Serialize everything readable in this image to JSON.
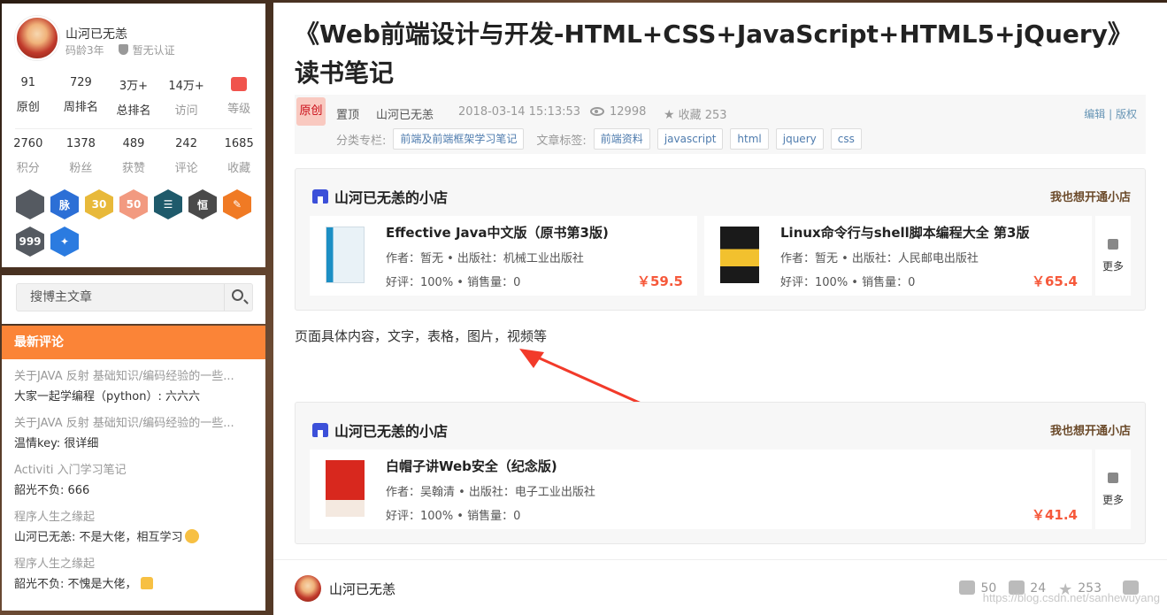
{
  "profile": {
    "name": "山河已无恙",
    "age": "码龄3年",
    "cert": "暂无认证",
    "row1": [
      {
        "v": "91",
        "l": "原创"
      },
      {
        "v": "729",
        "l": "周排名"
      },
      {
        "v": "3万+",
        "l": "总排名"
      },
      {
        "v": "14万+",
        "l": "访问"
      },
      {
        "v": "",
        "l": "等级"
      }
    ],
    "row2": [
      {
        "v": "2760",
        "l": "积分"
      },
      {
        "v": "1378",
        "l": "粉丝"
      },
      {
        "v": "489",
        "l": "获赞"
      },
      {
        "v": "242",
        "l": "评论"
      },
      {
        "v": "1685",
        "l": "收藏"
      }
    ],
    "badges": [
      {
        "name": "github-badge",
        "text": "",
        "color": "#555a61"
      },
      {
        "name": "mai-badge",
        "text": "脉",
        "color": "#2c6fd6"
      },
      {
        "name": "30-badge",
        "text": "30",
        "color": "#e8b93a"
      },
      {
        "name": "50-badge",
        "text": "50",
        "color": "#f29a80"
      },
      {
        "name": "list-badge",
        "text": "☰",
        "color": "#1f5a6b"
      },
      {
        "name": "qi-badge",
        "text": "恒",
        "color": "#4a4a4a"
      },
      {
        "name": "pen-badge",
        "text": "✎",
        "color": "#f07a24"
      },
      {
        "name": "999-badge",
        "text": "999",
        "color": "#555a61"
      },
      {
        "name": "blue-badge",
        "text": "✦",
        "color": "#2b7be0"
      }
    ]
  },
  "search": {
    "placeholder": "搜博主文章"
  },
  "comments": {
    "title": "最新评论",
    "items": [
      {
        "article": "关于JAVA 反射 基础知识/编码经验的一些...",
        "text": "大家一起学编程（python）: 六六六"
      },
      {
        "article": "关于JAVA 反射 基础知识/编码经验的一些...",
        "text": "温情key: 很详细"
      },
      {
        "article": "Activiti 入门学习笔记",
        "text": "韶光不负: 666"
      },
      {
        "article": "程序人生之缘起",
        "text": "山河已无恙: 不是大佬，相互学习"
      },
      {
        "article": "程序人生之缘起",
        "text": "韶光不负: 不愧是大佬，"
      }
    ]
  },
  "article": {
    "title": "《Web前端设计与开发-HTML+CSS+JavaScript+HTML5+jQuery》读书笔记",
    "orig": "原创",
    "top": "置顶",
    "author": "山河已无恙",
    "date": "2018-03-14 15:13:53",
    "views": "12998",
    "fav": "收藏 253",
    "edit": "编辑",
    "copyright": "版权",
    "col_label": "分类专栏:",
    "column": "前端及前端框架学习笔记",
    "tag_label": "文章标签:",
    "tags": [
      "前端资料",
      "javascript",
      "html",
      "jquery",
      "css"
    ]
  },
  "shop1": {
    "title": "山河已无恙的小店",
    "open": "我也想开通小店",
    "more": "更多",
    "products": [
      {
        "name": "Effective Java中文版（原书第3版)",
        "meta": "作者：暂无 • 出版社：机械工业出版社",
        "rate": "好评：100%  •  销售量：0",
        "price": "￥59.5"
      },
      {
        "name": "Linux命令行与shell脚本编程大全 第3版",
        "meta": "作者：暂无 • 出版社：人民邮电出版社",
        "rate": "好评：100%  •  销售量：0",
        "price": "￥65.4"
      }
    ]
  },
  "content": "页面具体内容，文字，表格，图片，视频等",
  "shop2": {
    "title": "山河已无恙的小店",
    "open": "我也想开通小店",
    "more": "更多",
    "products": [
      {
        "name": "白帽子讲Web安全（纪念版)",
        "meta": "作者：吴翰清 • 出版社：电子工业出版社",
        "rate": "好评：100%  •  销售量：0",
        "price": "￥41.4"
      }
    ]
  },
  "footer": {
    "name": "山河已无恙",
    "likes": "50",
    "comments": "24",
    "favs": "253"
  },
  "watermark": "https://blog.csdn.net/sanhewuyang",
  "colors": {
    "accent": "#fb8437",
    "price": "#f6593b",
    "link": "#4f7cae"
  }
}
